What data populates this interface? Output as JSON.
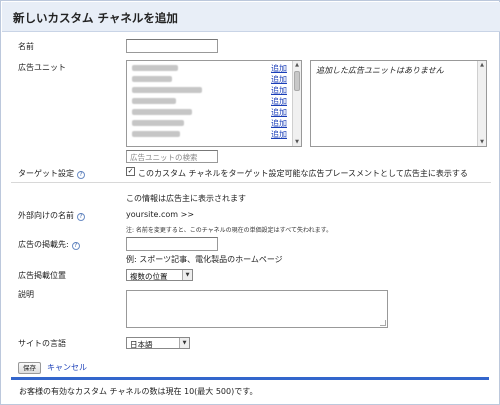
{
  "dialog": {
    "title": "新しいカスタム チャネルを追加"
  },
  "form": {
    "name_label": "名前",
    "name_value": "",
    "ad_units_label": "広告ユニット",
    "ad_units_add": [
      "追加",
      "追加",
      "追加",
      "追加",
      "追加",
      "追加",
      "追加"
    ],
    "selected_empty": "追加した広告ユニットはありません",
    "search_placeholder": "広告ユニットの検索",
    "targeting_label": "ターゲット設定",
    "targeting_checked": true,
    "targeting_text": "このカスタム チャネルをターゲット設定可能な広告プレースメントとして広告主に表示する",
    "advertiser_info": "この情報は広告主に表示されます",
    "public_name_label": "外部向けの名前",
    "public_name_value": "yoursite.com >>",
    "public_name_note": "注: 名前を変更すると、このチャネルの現在の単価設定はすべて失われます。",
    "placement_label": "広告の掲載先:",
    "placement_value": "",
    "placement_example": "例: スポーツ記事、電化製品のホームページ",
    "position_label": "広告掲載位置",
    "position_value": "複数の位置",
    "description_label": "説明",
    "description_value": "",
    "language_label": "サイトの言語",
    "language_value": "日本語"
  },
  "actions": {
    "save_label": "保存",
    "cancel_label": "キャンセル"
  },
  "footer": {
    "text": "お客様の有効なカスタム チャネルの数は現在 10(最大 500)です。"
  },
  "colors": {
    "accent": "#3366cc",
    "link": "#1a3eb8",
    "titlebar": "#e8eef7"
  }
}
